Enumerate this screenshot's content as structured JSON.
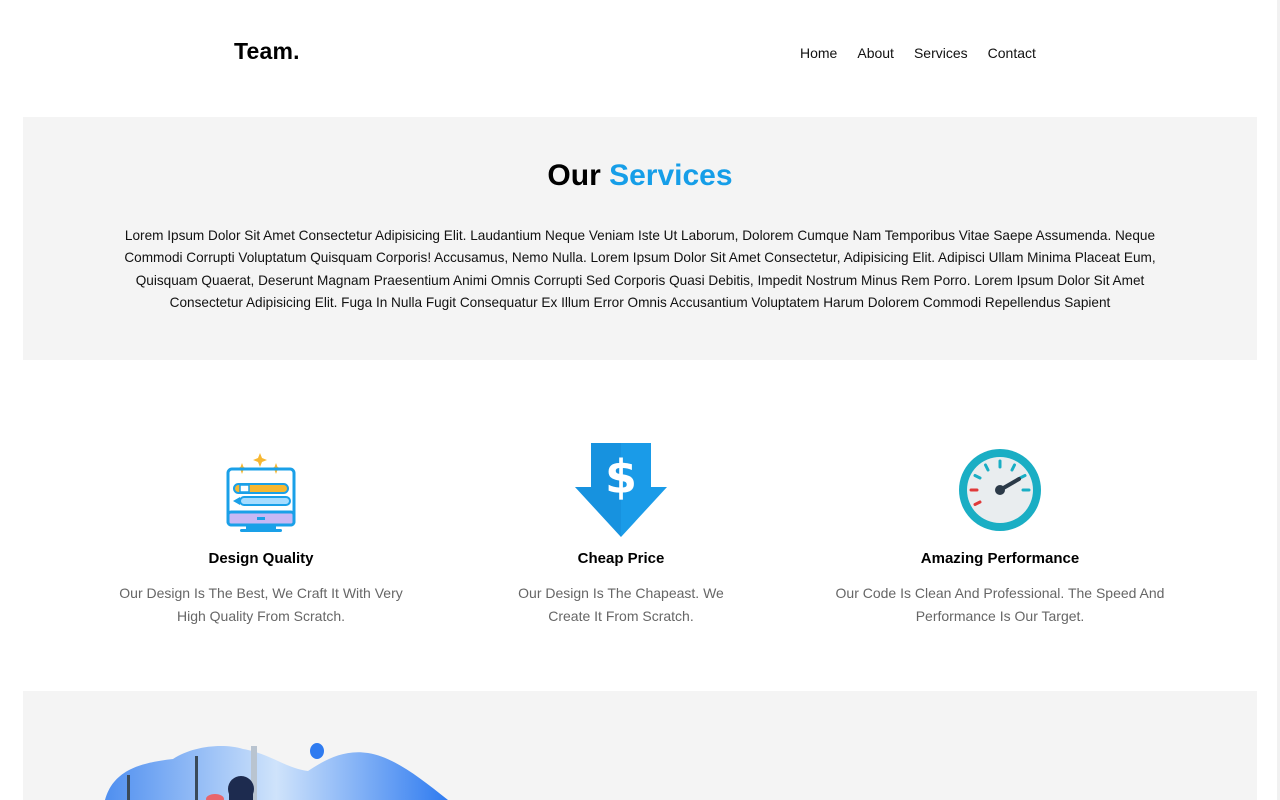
{
  "header": {
    "logo": "Team.",
    "nav": [
      "Home",
      "About",
      "Services",
      "Contact"
    ]
  },
  "services": {
    "title_plain": "Our",
    "title_accent": "Services",
    "description": "Lorem Ipsum Dolor Sit Amet Consectetur Adipisicing Elit. Laudantium Neque Veniam Iste Ut Laborum, Dolorem Cumque Nam Temporibus Vitae Saepe Assumenda. Neque Commodi Corrupti Voluptatum Quisquam Corporis! Accusamus, Nemo Nulla. Lorem Ipsum Dolor Sit Amet Consectetur, Adipisicing Elit. Adipisci Ullam Minima Placeat Eum, Quisquam Quaerat, Deserunt Magnam Praesentium Animi Omnis Corrupti Sed Corporis Quasi Debitis, Impedit Nostrum Minus Rem Porro. Lorem Ipsum Dolor Sit Amet Consectetur Adipisicing Elit. Fuga In Nulla Fugit Consequatur Ex Illum Error Omnis Accusantium Voluptatem Harum Dolorem Commodi Repellendus Sapient"
  },
  "cards": [
    {
      "icon": "design-monitor-icon",
      "title": "Design Quality",
      "text": "Our Design Is The Best, We Craft It With Very High Quality From Scratch."
    },
    {
      "icon": "dollar-arrow-icon",
      "title": "Cheap Price",
      "text": "Our Design Is The Chapeast. We Create It From Scratch."
    },
    {
      "icon": "speedometer-icon",
      "title": "Amazing Performance",
      "text": "Our Code Is Clean And Professional. The Speed And Performance Is Our Target."
    }
  ],
  "colors": {
    "accent": "#169ee8",
    "band_bg": "#f4f4f4"
  }
}
